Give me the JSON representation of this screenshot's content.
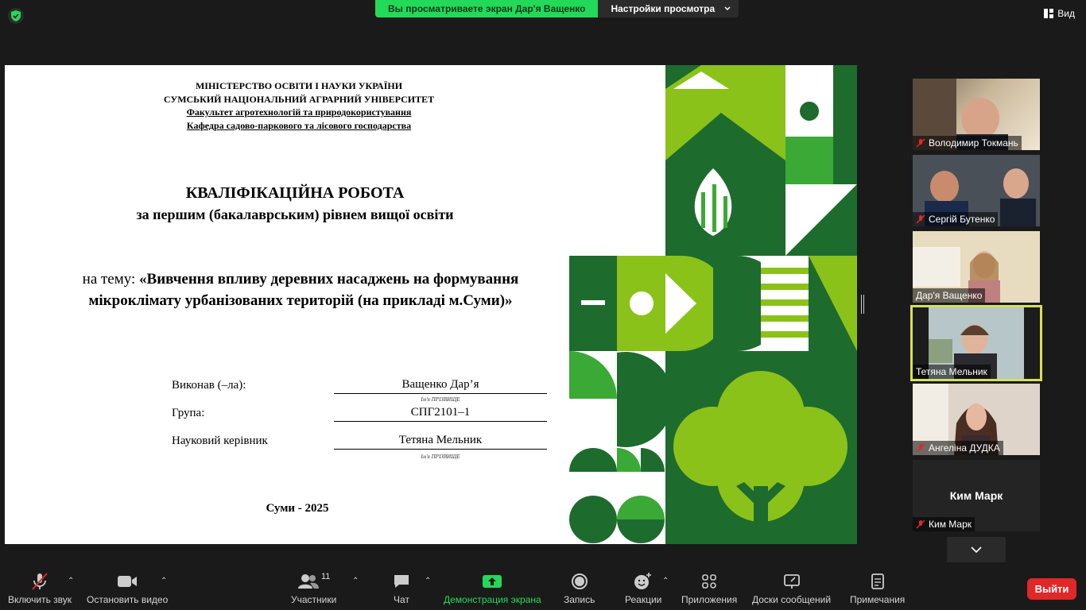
{
  "topbar": {
    "sharing_text": "Вы просматриваете экран Дар'я Ващенко",
    "view_options_label": "Настройки просмотра",
    "view_label": "Вид"
  },
  "slide": {
    "header_lines": [
      "МІНІСТЕРСТВО  ОСВІТИ  І НАУКИ УКРАЇНИ",
      "СУМСЬКИЙ НАЦІОНАЛЬНИЙ  АГРАРНИЙ УНІВЕРСИТЕТ",
      "Факультет агротехнологій та природокористування",
      "Кафедра садово-паркового та лісового господарства"
    ],
    "title": "КВАЛІФІКАЦІЙНА  РОБОТА",
    "subtitle": "за першим (бакалаврським) рівнем вищої освіти",
    "theme_prefix": "на тему: ",
    "theme_text": "«Вивчення  впливу деревних насаджень на формування мікроклімату урбанізованих територій (на прикладі м.Суми)»",
    "rows": [
      {
        "label": "Виконав (–ла):",
        "value": "Ващенко Дар’я",
        "sub": "Ім'я  ПРІЗВИЩЕ"
      },
      {
        "label": "Група:",
        "value": "СПГ2101–1",
        "sub": ""
      },
      {
        "label": "Науковий керівник",
        "value": "Тетяна Мельник",
        "sub": "Ім'я  ПРІЗВИЩЕ"
      }
    ],
    "city": "Суми - 2025"
  },
  "participants": [
    {
      "name": "Володимир Токмань",
      "muted": true
    },
    {
      "name": "Сергій Бутенко",
      "muted": true
    },
    {
      "name": "Дар'я Ващенко",
      "muted": false
    },
    {
      "name": "Тетяна Мельник",
      "muted": false
    },
    {
      "name": "Ангеліна ДУДКА",
      "muted": true
    },
    {
      "name": "Ким Марк",
      "muted": true,
      "center_name": "Ким Марк"
    }
  ],
  "toolbar": {
    "unmute": "Включить звук",
    "stop_video": "Остановить видео",
    "participants": "Участники",
    "participants_count": "11",
    "chat": "Чат",
    "share_screen": "Демонстрация экрана",
    "record": "Запись",
    "reactions": "Реакции",
    "apps": "Приложения",
    "whiteboards": "Доски сообщений",
    "notes": "Примечания",
    "leave": "Выйти"
  },
  "colors": {
    "accent_green": "#23d959",
    "dark_green": "#1e6b2e",
    "leaf_green": "#8ac21a",
    "leave_red": "#e02828"
  }
}
